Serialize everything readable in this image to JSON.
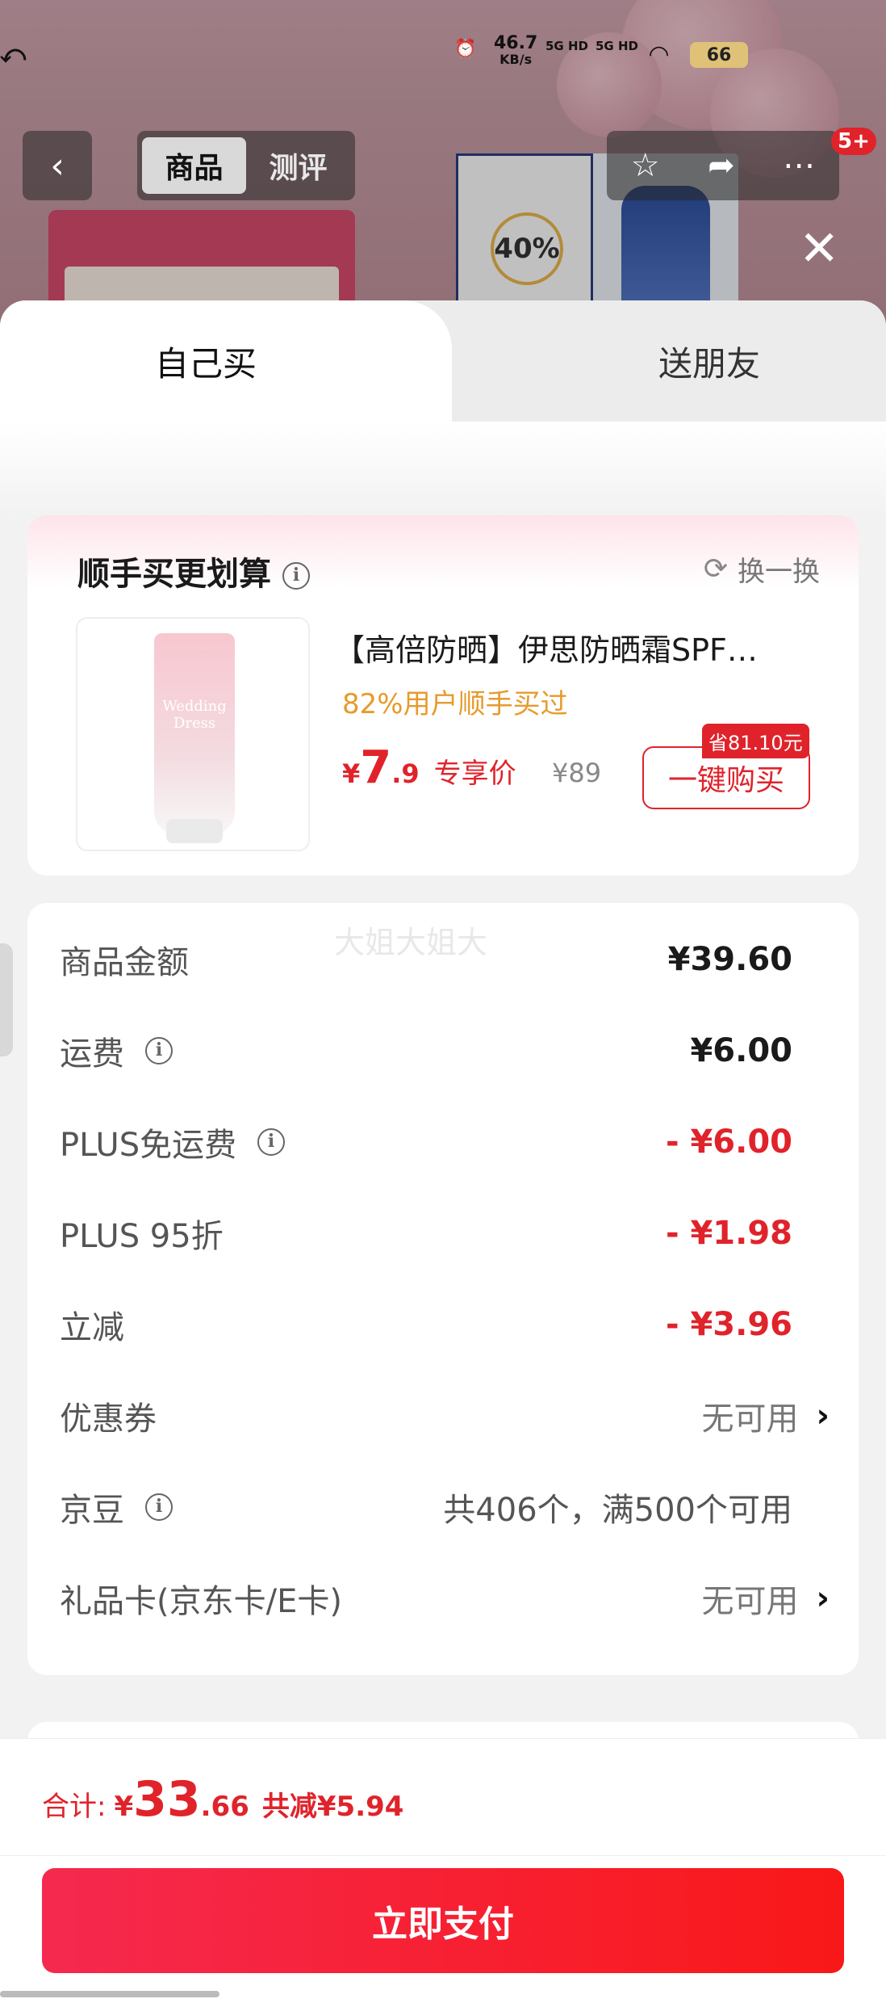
{
  "status_bar": {
    "net_speed": "46.7",
    "net_unit": "KB/s",
    "sim1": "5G HD",
    "sim2": "5G HD",
    "battery": "66"
  },
  "nav": {
    "tabs": [
      {
        "label": "商品",
        "active": true
      },
      {
        "label": "测评",
        "active": false
      }
    ],
    "notification_badge": "5+"
  },
  "sheet": {
    "tab_self": "自己买",
    "tab_gift": "送朋友"
  },
  "upsell": {
    "title": "顺手买更划算",
    "refresh_label": "换一换",
    "product_name": "【高倍防晒】伊思防晒霜SPF…",
    "bought_ratio": "82%用户顺手买过",
    "price_symbol": "¥",
    "price_int": "7",
    "price_dec": ".9",
    "price_tag": "专享价",
    "original_price": "¥89",
    "save_tag": "省81.10元",
    "buy_button": "一键购买"
  },
  "watermark": "大姐大姐大",
  "details": {
    "rows": [
      {
        "label": "商品金额",
        "value": "¥39.60",
        "info": false,
        "style": "bold"
      },
      {
        "label": "运费",
        "value": "¥6.00",
        "info": true,
        "style": "bold"
      },
      {
        "label": "PLUS免运费",
        "value": "- ¥6.00",
        "info": true,
        "style": "red"
      },
      {
        "label": "PLUS 95折",
        "value": "- ¥1.98",
        "info": false,
        "style": "red"
      },
      {
        "label": "立减",
        "value": "- ¥3.96",
        "info": false,
        "style": "red"
      },
      {
        "label": "优惠券",
        "value": "无可用",
        "info": false,
        "style": "muted",
        "chevron": true
      },
      {
        "label": "京豆",
        "value": "共406个，满500个可用",
        "info": true,
        "style": "plain"
      },
      {
        "label": "礼品卡(京东卡/E卡)",
        "value": "无可用",
        "info": false,
        "style": "muted",
        "chevron": true
      }
    ]
  },
  "footer": {
    "total_label": "合计:",
    "total_symbol": "¥",
    "total_int": "33",
    "total_dec": ".66",
    "saved": "共减¥5.94",
    "pay_button": "立即支付"
  },
  "colors": {
    "accent_red": "#e0232b",
    "bought_orange": "#e69b2c"
  }
}
